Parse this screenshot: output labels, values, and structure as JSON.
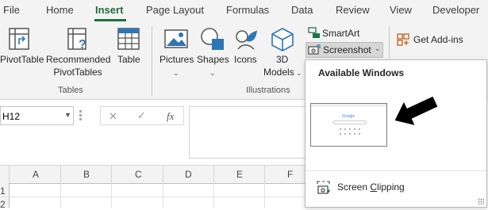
{
  "tabs": [
    "File",
    "Home",
    "Insert",
    "Page Layout",
    "Formulas",
    "Data",
    "Review",
    "View",
    "Developer"
  ],
  "active_tab": "Insert",
  "ribbon": {
    "tables_group": {
      "label": "Tables",
      "pivottable": "PivotTable",
      "recommended_line1": "Recommended",
      "recommended_line2": "PivotTables",
      "table": "Table"
    },
    "illustrations_group": {
      "label": "Illustrations",
      "pictures": "Pictures",
      "shapes": "Shapes",
      "icons": "Icons",
      "models_line1": "3D",
      "models_line2": "Models",
      "smartart": "SmartArt",
      "screenshot": "Screenshot"
    },
    "get_addins": "Get Add-ins"
  },
  "name_box": {
    "value": "H12"
  },
  "formula_bar": {
    "fx_label": "fx",
    "cancel_glyph": "✕",
    "enter_glyph": "✓"
  },
  "grid": {
    "columns": [
      "A",
      "B",
      "C",
      "D",
      "E",
      "F"
    ],
    "rows": [
      "1",
      "2"
    ]
  },
  "screenshot_dropdown": {
    "title": "Available Windows",
    "thumbnail_caption": "Google",
    "screen_clipping_prefix": "Screen ",
    "screen_clipping_accel": "C",
    "screen_clipping_suffix": "lipping"
  },
  "icons": [
    "pivottable-icon",
    "recommended-pivottables-icon",
    "table-icon",
    "pictures-icon",
    "shapes-icon",
    "icons-icon",
    "3d-models-icon",
    "smartart-icon",
    "screenshot-icon",
    "store-icon",
    "screen-clipping-icon",
    "arrow-pointer-icon"
  ],
  "colors": {
    "accent_green": "#1e7145",
    "ribbon_bg": "#f3f3f3",
    "icon_blue": "#2e75b6"
  }
}
